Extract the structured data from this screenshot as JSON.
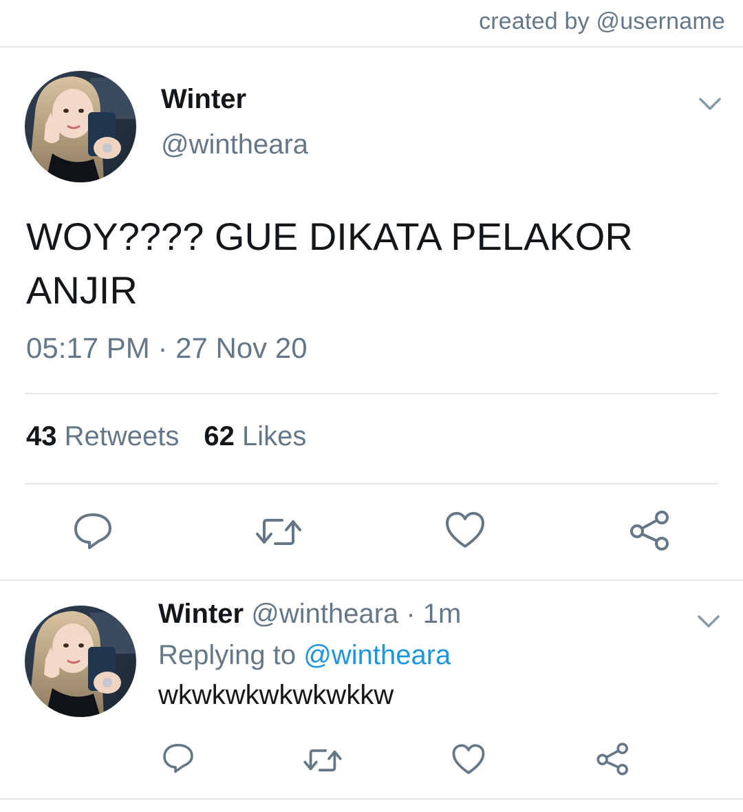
{
  "credit": "created by @username",
  "main_tweet": {
    "author_name": "Winter",
    "author_handle": "@wintheara",
    "text_line1": "WOY???? GUE DIKATA PELAKOR",
    "text_line2": "ANJIR",
    "timestamp": "05:17 PM · 27 Nov 20",
    "retweet_count": "43",
    "retweet_label": "Retweets",
    "like_count": "62",
    "like_label": "Likes",
    "actions": [
      "reply-icon",
      "retweet-icon",
      "like-icon",
      "share-icon"
    ]
  },
  "reply_tweet": {
    "author_name": "Winter",
    "author_handle": "@wintheara",
    "time_sep": " · ",
    "time": "1m",
    "replying_prefix": "Replying to ",
    "replying_to": "@wintheara",
    "text": "wkwkwkwkwkwkkw",
    "actions": [
      "reply-icon",
      "retweet-icon",
      "like-icon",
      "share-icon"
    ]
  },
  "colors": {
    "text": "#14171a",
    "secondary": "#657786",
    "link": "#1b95e0",
    "divider": "#e1e8ed"
  }
}
